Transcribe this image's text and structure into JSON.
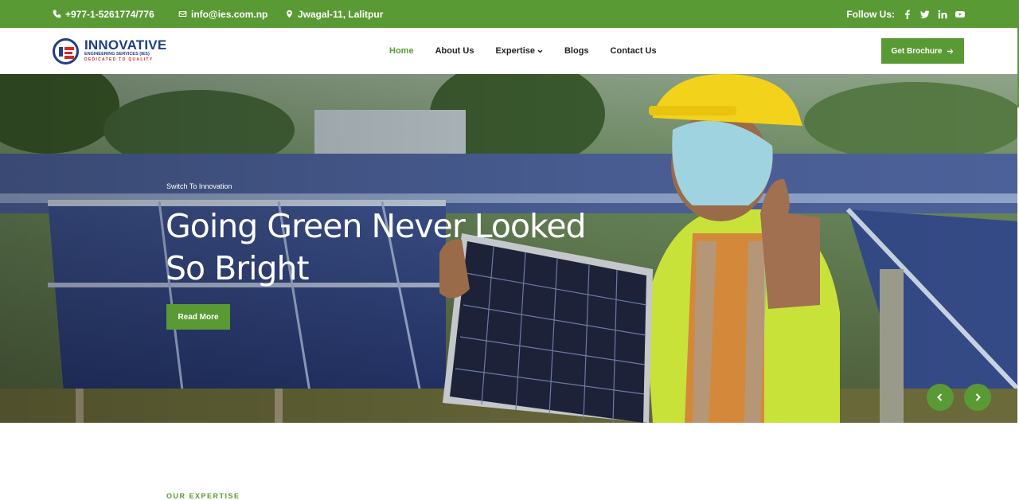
{
  "topbar": {
    "phone": "+977-1-5261774/776",
    "email": "info@ies.com.np",
    "address": "Jwagal-11, Lalitpur",
    "follow_label": "Follow Us:",
    "social": [
      "facebook-icon",
      "twitter-icon",
      "linkedin-icon",
      "youtube-icon"
    ]
  },
  "logo": {
    "title": "INNOVATIVE",
    "subtitle": "ENGINEERING SERVICES (IES)",
    "tagline": "DEDICATED TO QUALITY"
  },
  "nav": {
    "items": [
      {
        "label": "Home",
        "active": true
      },
      {
        "label": "About Us"
      },
      {
        "label": "Expertise",
        "dropdown": true
      },
      {
        "label": "Blogs"
      },
      {
        "label": "Contact Us"
      }
    ]
  },
  "header": {
    "brochure_label": "Get Brochure"
  },
  "hero": {
    "subtitle": "Switch To Innovation",
    "title": "Going Green Never Looked So Bright",
    "button_label": "Read More"
  },
  "section": {
    "label": "OUR EXPERTISE"
  },
  "colors": {
    "accent": "#5a9a34",
    "brand_blue": "#1f3f86",
    "brand_red": "#d22b2b"
  }
}
